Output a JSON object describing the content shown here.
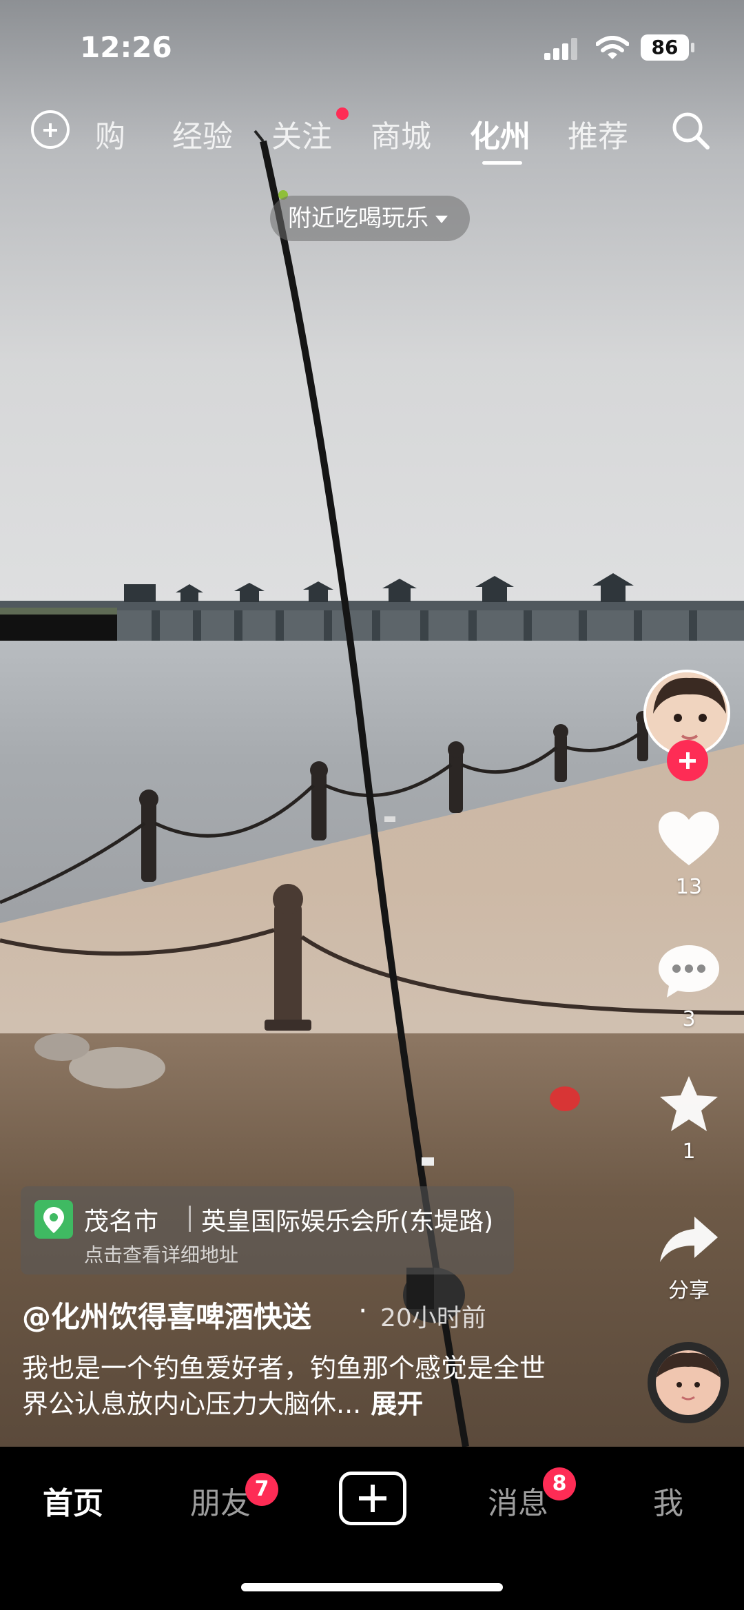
{
  "status_bar": {
    "time": "12:26",
    "battery": "86"
  },
  "top_tabs": [
    {
      "label": "购",
      "active": false
    },
    {
      "label": "经验",
      "active": false
    },
    {
      "label": "关注",
      "active": false,
      "dot": true
    },
    {
      "label": "商城",
      "active": false
    },
    {
      "label": "化州",
      "active": true
    },
    {
      "label": "推荐",
      "active": false
    }
  ],
  "nearby_pill": "附近吃喝玩乐",
  "actions": {
    "like_count": "13",
    "comment_count": "3",
    "favorite_count": "1",
    "share_label": "分享"
  },
  "location": {
    "city": "茂名市",
    "place": "英皇国际娱乐会所(东堤路)",
    "hint": "点击查看详细地址"
  },
  "post": {
    "author": "@化州饮得喜啤酒快送",
    "separator": "·",
    "time": "20小时前",
    "caption": "我也是一个钓鱼爱好者，钓鱼那个感觉是全世界公认息放内心压力大脑休...",
    "expand_label": "展开"
  },
  "bottom_nav": {
    "home": "首页",
    "friends": "朋友",
    "friends_badge": "7",
    "messages": "消息",
    "messages_badge": "8",
    "me": "我"
  },
  "colors": {
    "accent": "#fe2c55",
    "location_pin": "#3fba62"
  }
}
